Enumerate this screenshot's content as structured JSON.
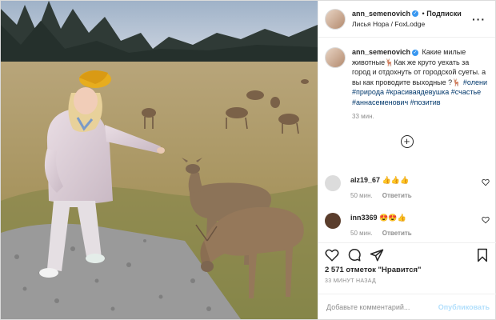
{
  "post": {
    "username": "ann_semenovich",
    "verified_mark": "✓",
    "separator": "•",
    "follow_label": "Подписки",
    "location": "Лисья Нора / FoxLodge",
    "more_icon": "more-horizontal-icon"
  },
  "caption": {
    "username": "ann_semenovich",
    "text_1": "Какие милые животные",
    "emoji_1": "🦌",
    "text_2": "Как же круто уехать за город и отдохнуть от городской суеты. а вы как проводите выходные ?",
    "emoji_2": "🦌",
    "hashtags": [
      "#олени",
      "#природа",
      "#красиваядевушка",
      "#счастье",
      "#аннасеменович",
      "#позитив"
    ],
    "time": "33 мин."
  },
  "comments": [
    {
      "username": "alz19_67",
      "text": "👍👍👍",
      "time": "50 мин.",
      "reply": "Ответить"
    },
    {
      "username": "inn3369",
      "text": "😍😍👍",
      "time": "50 мин.",
      "reply": "Ответить"
    }
  ],
  "likes_text": "2 571 отметок \"Нравится\"",
  "date_text": "33 МИНУТ НАЗАД",
  "comment_input": {
    "placeholder": "Добавьте комментарий...",
    "value": ""
  },
  "publish_label": "Опубликовать",
  "colors": {
    "accent": "#3897f0",
    "publish_disabled": "#b2dffc",
    "hashtag": "#00376b",
    "meta": "#8e8e8e"
  }
}
